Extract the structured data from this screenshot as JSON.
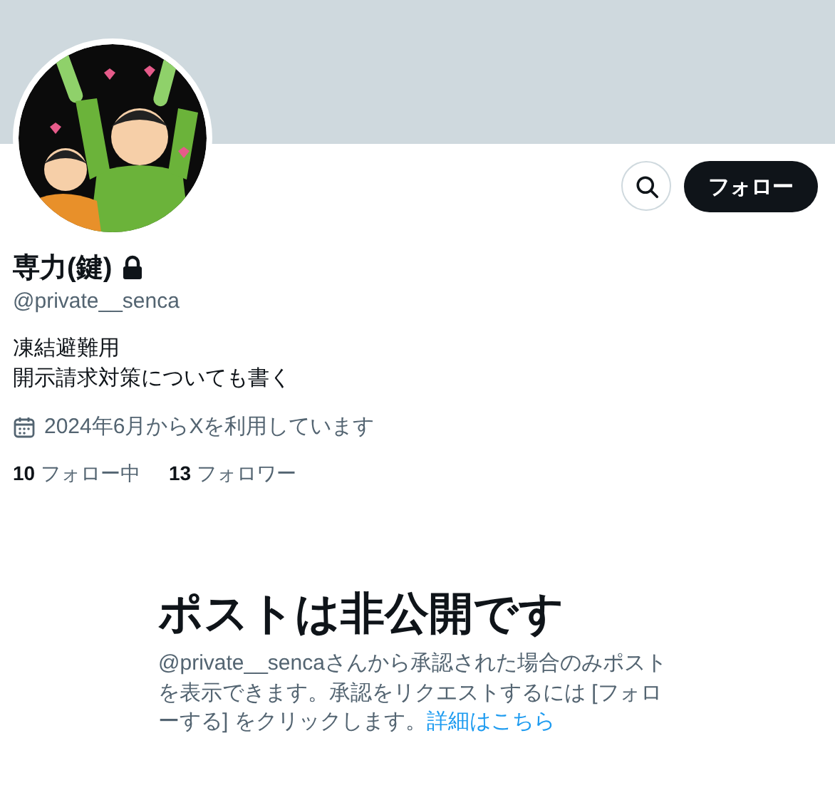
{
  "profile": {
    "display_name": "専力(鍵)",
    "locked": true,
    "handle": "@private__senca",
    "bio": [
      "凍結避難用",
      "開示請求対策についても書く"
    ],
    "joined": "2024年6月からXを利用しています"
  },
  "actions": {
    "follow_button": "フォロー"
  },
  "stats": [
    {
      "count": "10",
      "label": "フォロー中"
    },
    {
      "count": "13",
      "label": "フォロワー"
    }
  ],
  "private_notice": {
    "title": "ポストは非公開です",
    "text": "@private__sencaさんから承認された場合のみポストを表示できます。承認をリクエストするには [フォローする] をクリックします。",
    "link": "詳細はこちら"
  }
}
